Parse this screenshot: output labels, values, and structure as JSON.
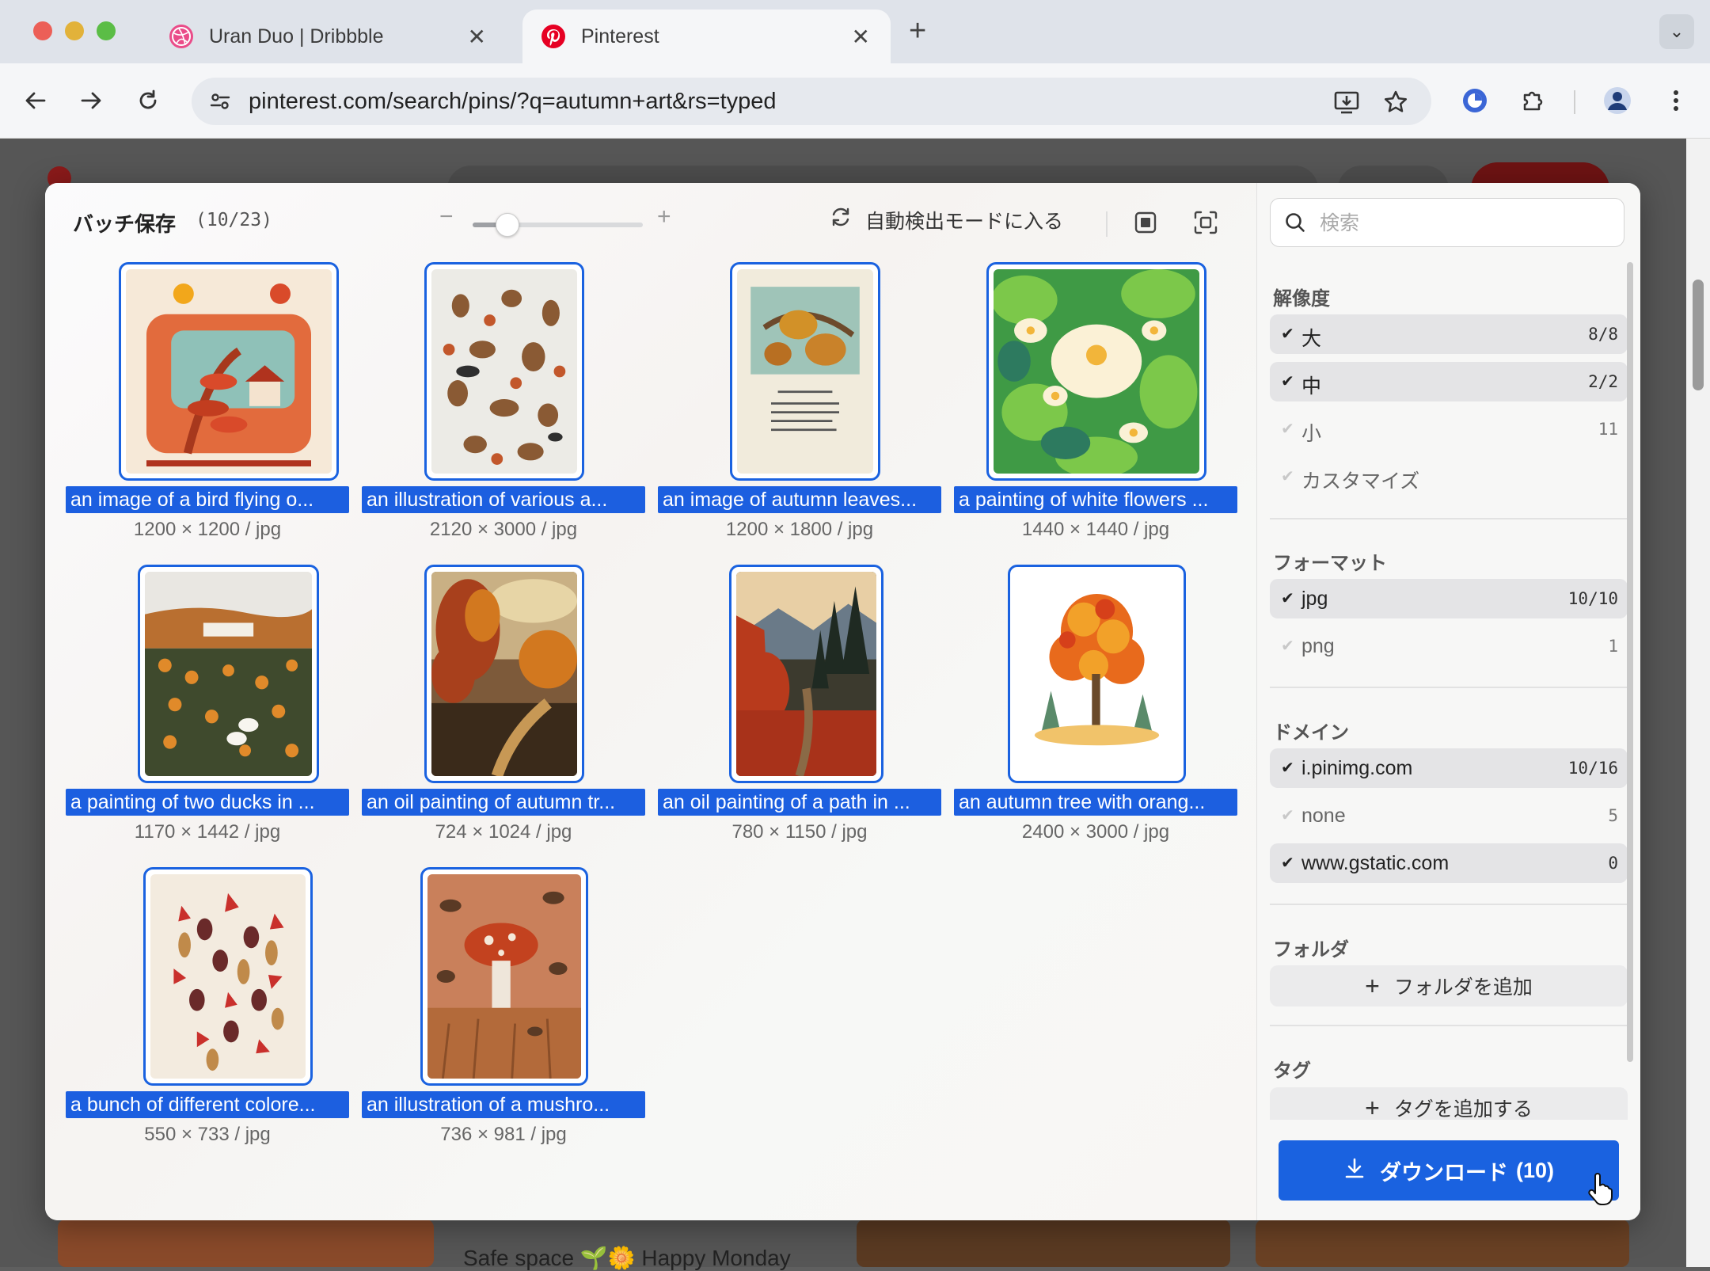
{
  "browser": {
    "tabs": [
      {
        "title": "Uran Duo | Dribbble",
        "active": false,
        "close": "✕"
      },
      {
        "title": "Pinterest",
        "active": true,
        "close": "✕"
      }
    ],
    "new_tab": "+",
    "url": "pinterest.com/search/pins/?q=autumn+art&rs=typed"
  },
  "modal": {
    "title": "バッチ保存",
    "count": "(10/23)",
    "zoom": {
      "minus": "−",
      "plus": "+",
      "level": 0.2
    },
    "auto_detect_label": "自動検出モードに入る",
    "images": [
      {
        "caption": "an image of a bird flying o...",
        "dims": "1200 × 1200 / jpg"
      },
      {
        "caption": "an illustration of various a...",
        "dims": "2120 × 3000 / jpg"
      },
      {
        "caption": "an image of autumn leaves...",
        "dims": "1200 × 1800 / jpg"
      },
      {
        "caption": "a painting of white flowers ...",
        "dims": "1440 × 1440 / jpg"
      },
      {
        "caption": "a painting of two ducks in ...",
        "dims": "1170 × 1442 / jpg"
      },
      {
        "caption": "an oil painting of autumn tr...",
        "dims": "724 × 1024 / jpg"
      },
      {
        "caption": "an oil painting of a path in ...",
        "dims": "780 × 1150 / jpg"
      },
      {
        "caption": "an autumn tree with orang...",
        "dims": "2400 × 3000 / jpg"
      },
      {
        "caption": "a bunch of different colore...",
        "dims": "550 × 733 / jpg"
      },
      {
        "caption": "an illustration of a mushro...",
        "dims": "736 × 981 / jpg"
      }
    ]
  },
  "sidebar": {
    "search_placeholder": "検索",
    "resolution": {
      "title": "解像度",
      "items": [
        {
          "label": "大",
          "count": "8/8",
          "checked": true
        },
        {
          "label": "中",
          "count": "2/2",
          "checked": true
        },
        {
          "label": "小",
          "count": "11",
          "checked": false
        },
        {
          "label": "カスタマイズ",
          "count": "",
          "checked": false
        }
      ]
    },
    "format": {
      "title": "フォーマット",
      "items": [
        {
          "label": "jpg",
          "count": "10/10",
          "checked": true
        },
        {
          "label": "png",
          "count": "1",
          "checked": false
        }
      ]
    },
    "domain": {
      "title": "ドメイン",
      "items": [
        {
          "label": "i.pinimg.com",
          "count": "10/16",
          "checked": true
        },
        {
          "label": "none",
          "count": "5",
          "checked": false
        },
        {
          "label": "www.gstatic.com",
          "count": "0",
          "checked": true
        }
      ]
    },
    "folder": {
      "title": "フォルダ",
      "add_label": "フォルダを追加"
    },
    "tags": {
      "title": "タグ",
      "add_label": "タグを追加する"
    },
    "download": {
      "label": "ダウンロード",
      "count": "(10)"
    }
  },
  "background_page": {
    "text": "Safe space 🌱🌼 Happy Monday"
  },
  "colors": {
    "accent": "#1a62e0",
    "tab_bar": "#dfe3ea",
    "overlay": "#565656"
  }
}
